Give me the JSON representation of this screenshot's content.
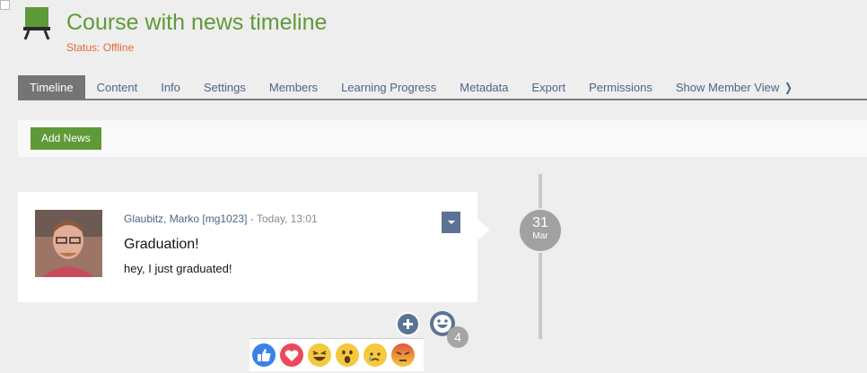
{
  "header": {
    "title": "Course with news timeline",
    "status": "Status: Offline",
    "icon": "course-board-icon"
  },
  "tabs": [
    {
      "label": "Timeline",
      "active": true
    },
    {
      "label": "Content"
    },
    {
      "label": "Info"
    },
    {
      "label": "Settings"
    },
    {
      "label": "Members"
    },
    {
      "label": "Learning Progress"
    },
    {
      "label": "Metadata"
    },
    {
      "label": "Export"
    },
    {
      "label": "Permissions"
    },
    {
      "label": "Show Member View",
      "icon": "chevron-right-icon"
    }
  ],
  "toolbar": {
    "add_news_label": "Add News"
  },
  "news": {
    "author": "Glaubitz, Marko [mg1023]",
    "time": " - Today, 13:01",
    "title": "Graduation!",
    "body": "hey, I just graduated!",
    "date_day": "31",
    "date_month": "Mar",
    "reaction_count": "4"
  },
  "reactions": [
    "like-icon",
    "love-icon",
    "laugh-icon",
    "wow-icon",
    "sad-icon",
    "angry-icon"
  ],
  "colors": {
    "accent_green": "#5f9a38",
    "status_orange": "#e06a35",
    "link_blue": "#4c6586"
  }
}
